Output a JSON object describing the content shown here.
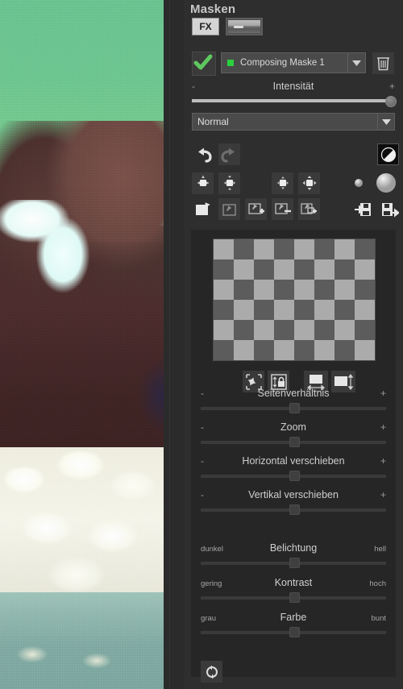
{
  "panel": {
    "title": "Masken",
    "tabs": [
      {
        "label": "FX",
        "name": "tab-fx",
        "selected": true
      },
      {
        "label": "",
        "name": "tab-image-thumbnail",
        "selected": false
      }
    ]
  },
  "mask_row": {
    "enabled_icon": "checkmark-icon",
    "selected_mask": "Composing Maske 1",
    "swatch_color": "#2ad13d",
    "dropdown_icon": "chevron-down-icon",
    "delete_icon": "trash-icon"
  },
  "intensity": {
    "label": "Intensität",
    "minus": "-",
    "plus": "+",
    "value_pct": 100
  },
  "blend_mode": {
    "selected": "Normal",
    "dropdown_icon": "chevron-down-icon"
  },
  "tool_rows": {
    "row1": [
      {
        "name": "undo-icon",
        "enabled": true
      },
      {
        "name": "redo-icon",
        "enabled": false
      },
      {
        "name": "invert-mask-icon",
        "enabled": true
      },
      {
        "name": "brush-tool-icon",
        "enabled": true
      }
    ],
    "row2": [
      {
        "name": "brush-size-decrease-icon"
      },
      {
        "name": "brush-size-increase-icon"
      },
      {
        "name": "brush-hardness-decrease-icon"
      },
      {
        "name": "brush-hardness-increase-icon"
      },
      {
        "name": "brush-preview-small-icon"
      },
      {
        "name": "brush-preview-large-icon"
      }
    ],
    "row3": [
      {
        "name": "mask-new-icon"
      },
      {
        "name": "mask-copy-icon"
      },
      {
        "name": "mask-add-icon"
      },
      {
        "name": "mask-subtract-icon"
      },
      {
        "name": "mask-intersect-icon"
      },
      {
        "name": "mask-load-icon"
      },
      {
        "name": "mask-save-icon"
      }
    ]
  },
  "preview": {
    "checker_dark": "#5c5c5c",
    "checker_light": "#ababab",
    "buttons": [
      {
        "name": "free-transform-icon"
      },
      {
        "name": "lock-aspect-icon"
      },
      {
        "name": "fit-width-icon"
      },
      {
        "name": "fit-height-icon"
      }
    ]
  },
  "sliders": [
    {
      "label": "Seitenverhältnis",
      "left": "-",
      "right": "+",
      "value_pct": 50,
      "knob": "flat"
    },
    {
      "label": "Zoom",
      "left": "-",
      "right": "+",
      "value_pct": 50,
      "knob": "flat"
    },
    {
      "label": "Horizontal verschieben",
      "left": "-",
      "right": "+",
      "value_pct": 50,
      "knob": "flat"
    },
    {
      "label": "Vertikal verschieben",
      "left": "-",
      "right": "+",
      "value_pct": 50,
      "knob": "flat"
    },
    {
      "label": "Belichtung",
      "left": "dunkel",
      "right": "hell",
      "value_pct": 50,
      "knob": "flat"
    },
    {
      "label": "Kontrast",
      "left": "gering",
      "right": "hoch",
      "value_pct": 50,
      "knob": "flat"
    },
    {
      "label": "Farbe",
      "left": "grau",
      "right": "bunt",
      "value_pct": 50,
      "knob": "flat"
    }
  ],
  "footer": {
    "reset_icon": "reset-rotate-icon"
  }
}
